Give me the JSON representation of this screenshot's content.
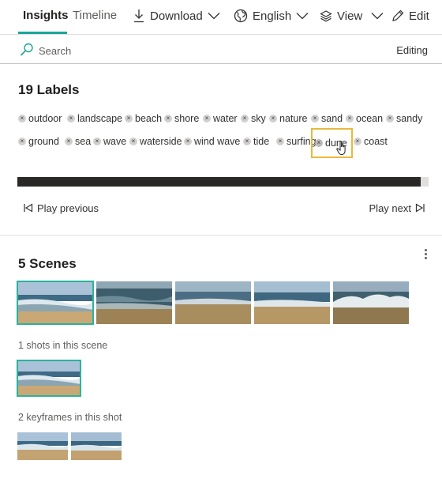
{
  "toolbar": {
    "tabs": [
      {
        "label": "Insights",
        "active": true
      },
      {
        "label": "Timeline",
        "active": false
      }
    ],
    "download_label": "Download",
    "language_label": "English",
    "view_label": "View",
    "edit_label": "Edit"
  },
  "search": {
    "placeholder": "Search",
    "mode_label": "Editing"
  },
  "labels": {
    "heading": "19 Labels",
    "items": [
      "outdoor",
      "landscape",
      "beach",
      "shore",
      "water",
      "sky",
      "nature",
      "sand",
      "ocean",
      "sandy",
      "ground",
      "sea",
      "wave",
      "waterside",
      "wind wave",
      "tide",
      "surfing",
      "dune",
      "coast"
    ],
    "highlighted": "dune",
    "remove_glyph": "×",
    "progress": 0.98
  },
  "player": {
    "play_previous": "Play previous",
    "play_next": "Play next"
  },
  "scenes": {
    "heading": "5 Scenes",
    "shots_caption": "1 shots in this scene",
    "keyframes_caption": "2 keyframes in this shot"
  },
  "icons": {
    "download": "download-icon",
    "language": "globe-icon",
    "view": "layers-icon",
    "edit": "pencil-icon",
    "search": "search-icon",
    "more": "more-vertical-icon"
  },
  "colors": {
    "accent": "#1aa59a",
    "selection": "#2bb39c",
    "highlight": "#e8b93c",
    "progress_fill": "#292827"
  }
}
